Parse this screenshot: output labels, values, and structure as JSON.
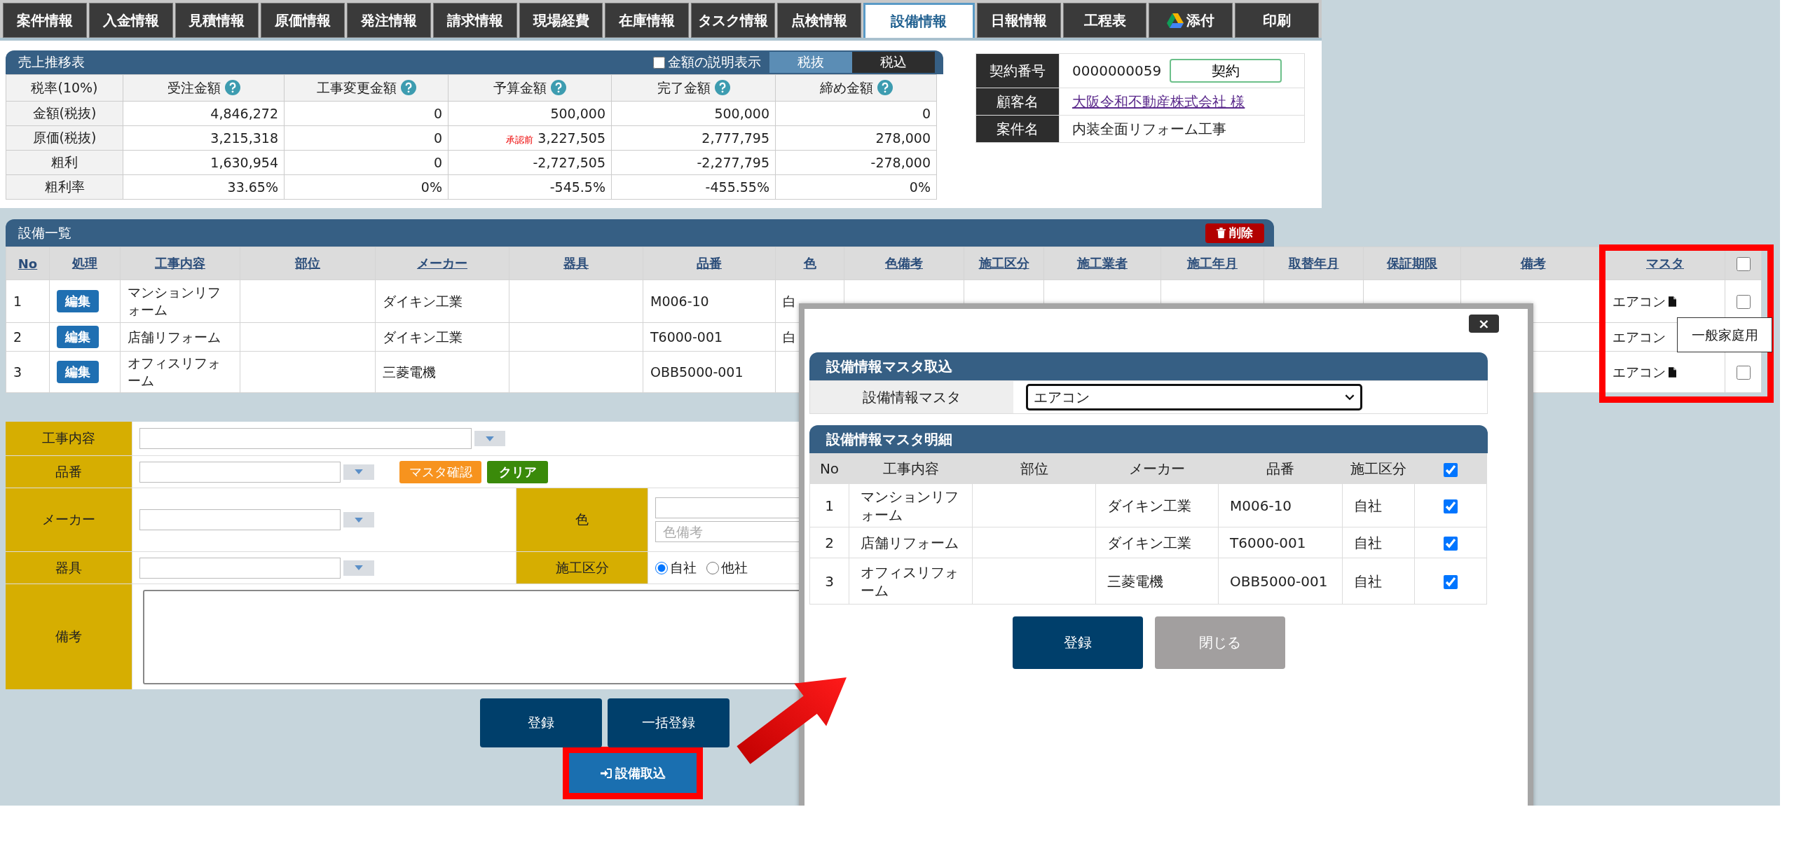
{
  "tabs": [
    {
      "label": "案件情報",
      "selected": false,
      "kind": "plain"
    },
    {
      "label": "入金情報",
      "selected": false,
      "kind": "plain"
    },
    {
      "label": "見積情報",
      "selected": false,
      "kind": "plain"
    },
    {
      "label": "原価情報",
      "selected": false,
      "kind": "plain"
    },
    {
      "label": "発注情報",
      "selected": false,
      "kind": "plain"
    },
    {
      "label": "請求情報",
      "selected": false,
      "kind": "plain"
    },
    {
      "label": "現場経費",
      "selected": false,
      "kind": "plain"
    },
    {
      "label": "在庫情報",
      "selected": false,
      "kind": "plain"
    },
    {
      "label": "タスク情報",
      "selected": false,
      "kind": "plain"
    },
    {
      "label": "点検情報",
      "selected": false,
      "kind": "plain"
    },
    {
      "label": "設備情報",
      "selected": true,
      "kind": "plain"
    },
    {
      "label": "日報情報",
      "selected": false,
      "kind": "plain"
    },
    {
      "label": "工程表",
      "selected": false,
      "kind": "plain"
    },
    {
      "label": "添付",
      "selected": false,
      "kind": "drive"
    },
    {
      "label": "印刷",
      "selected": false,
      "kind": "plain"
    }
  ],
  "sales": {
    "title": "売上推移表",
    "show_notes": {
      "label": "金額の説明表示",
      "checked": false
    },
    "tax_toggle": [
      {
        "label": "税抜",
        "selected": true
      },
      {
        "label": "税込",
        "selected": false
      }
    ],
    "columns": [
      {
        "label": "税率(10%)",
        "help": false
      },
      {
        "label": "受注金額",
        "help": true
      },
      {
        "label": "工事変更金額",
        "help": true
      },
      {
        "label": "予算金額",
        "help": true
      },
      {
        "label": "完了金額",
        "help": true
      },
      {
        "label": "締め金額",
        "help": true
      }
    ],
    "rows": [
      {
        "cells": [
          {
            "value": "金額(税抜)"
          },
          {
            "value": "4,846,272"
          },
          {
            "value": "0"
          },
          {
            "value": "500,000"
          },
          {
            "value": "500,000"
          },
          {
            "value": "0"
          }
        ]
      },
      {
        "cells": [
          {
            "value": "原価(税抜)"
          },
          {
            "value": "3,215,318"
          },
          {
            "value": "0"
          },
          {
            "note": "承認前",
            "value": "3,227,505"
          },
          {
            "value": "2,777,795"
          },
          {
            "value": "278,000"
          }
        ]
      },
      {
        "cells": [
          {
            "value": "粗利"
          },
          {
            "value": "1,630,954"
          },
          {
            "value": "0"
          },
          {
            "value": "-2,727,505"
          },
          {
            "value": "-2,277,795"
          },
          {
            "value": "-278,000"
          }
        ]
      },
      {
        "cells": [
          {
            "value": "粗利率"
          },
          {
            "value": "33.65%"
          },
          {
            "value": "0%"
          },
          {
            "value": "-545.5%"
          },
          {
            "value": "-455.55%"
          },
          {
            "value": "0%"
          }
        ]
      }
    ]
  },
  "contract": [
    {
      "label": "契約番号",
      "value": "0000000059",
      "kind": "number",
      "button": "契約"
    },
    {
      "label": "顧客名",
      "value": "大阪令和不動産株式会社 様",
      "kind": "link"
    },
    {
      "label": "案件名",
      "value": "内装全面リフォーム工事",
      "kind": "text"
    }
  ],
  "equipment": {
    "title": "設備一覧",
    "delete_button": "削除",
    "columns": [
      "No",
      "処理",
      "工事内容",
      "部位",
      "メーカー",
      "器具",
      "品番",
      "色",
      "色備考",
      "施工区分",
      "施工業者",
      "施工年月",
      "取替年月",
      "保証期限",
      "備考",
      "マスタ"
    ],
    "header_checkbox": {
      "checked": false
    },
    "rows": [
      {
        "no": "1",
        "edit": "編集",
        "work": "マンションリフォーム",
        "maker": "ダイキン工業",
        "part_no": "M006-10",
        "paint": "白",
        "master": "エアコン",
        "checked": false
      },
      {
        "no": "2",
        "edit": "編集",
        "work": "店舗リフォーム",
        "maker": "ダイキン工業",
        "part_no": "T6000-001",
        "paint": "白",
        "master": "エアコン",
        "tooltip": "一般家庭用"
      },
      {
        "no": "3",
        "edit": "編集",
        "work": "オフィスリフォーム",
        "maker": "三菱電機",
        "part_no": "OBB5000-001",
        "master": "エアコン",
        "checked": false
      }
    ]
  },
  "form": {
    "work": {
      "label": "工事内容"
    },
    "part_no": {
      "label": "品番",
      "buttons": [
        {
          "label": "マスタ確認",
          "kind": "check"
        },
        {
          "label": "クリア",
          "kind": "clear"
        }
      ]
    },
    "maker": {
      "label": "メーカー"
    },
    "color": {
      "label": "色",
      "note_placeholder": "色備考"
    },
    "fixture": {
      "label": "器具"
    },
    "construction": {
      "label": "施工区分",
      "options": [
        {
          "label": "自社",
          "selected": true
        },
        {
          "label": "他社",
          "selected": false
        }
      ]
    },
    "remarks": {
      "label": "備考"
    },
    "buttons": [
      "登録",
      "一括登録"
    ],
    "import_button": "設備取込"
  },
  "modal": {
    "close": "×",
    "import": {
      "title": "設備情報マスタ取込",
      "label": "設備情報マスタ",
      "value": "エアコン"
    },
    "detail": {
      "title": "設備情報マスタ明細",
      "columns": [
        "No",
        "工事内容",
        "部位",
        "メーカー",
        "品番",
        "施工区分"
      ],
      "header_checked": true,
      "rows": [
        {
          "no": "1",
          "work": "マンションリフォーム",
          "maker": "ダイキン工業",
          "part_no": "M006-10",
          "construction": "自社",
          "checked": true
        },
        {
          "no": "2",
          "work": "店舗リフォーム",
          "maker": "ダイキン工業",
          "part_no": "T6000-001",
          "construction": "自社",
          "checked": true
        },
        {
          "no": "3",
          "work": "オフィスリフォーム",
          "maker": "三菱電機",
          "part_no": "OBB5000-001",
          "construction": "自社",
          "checked": true
        }
      ]
    },
    "buttons": [
      {
        "label": "登録",
        "kind": "primary"
      },
      {
        "label": "閉じる",
        "kind": "secondary"
      }
    ]
  }
}
